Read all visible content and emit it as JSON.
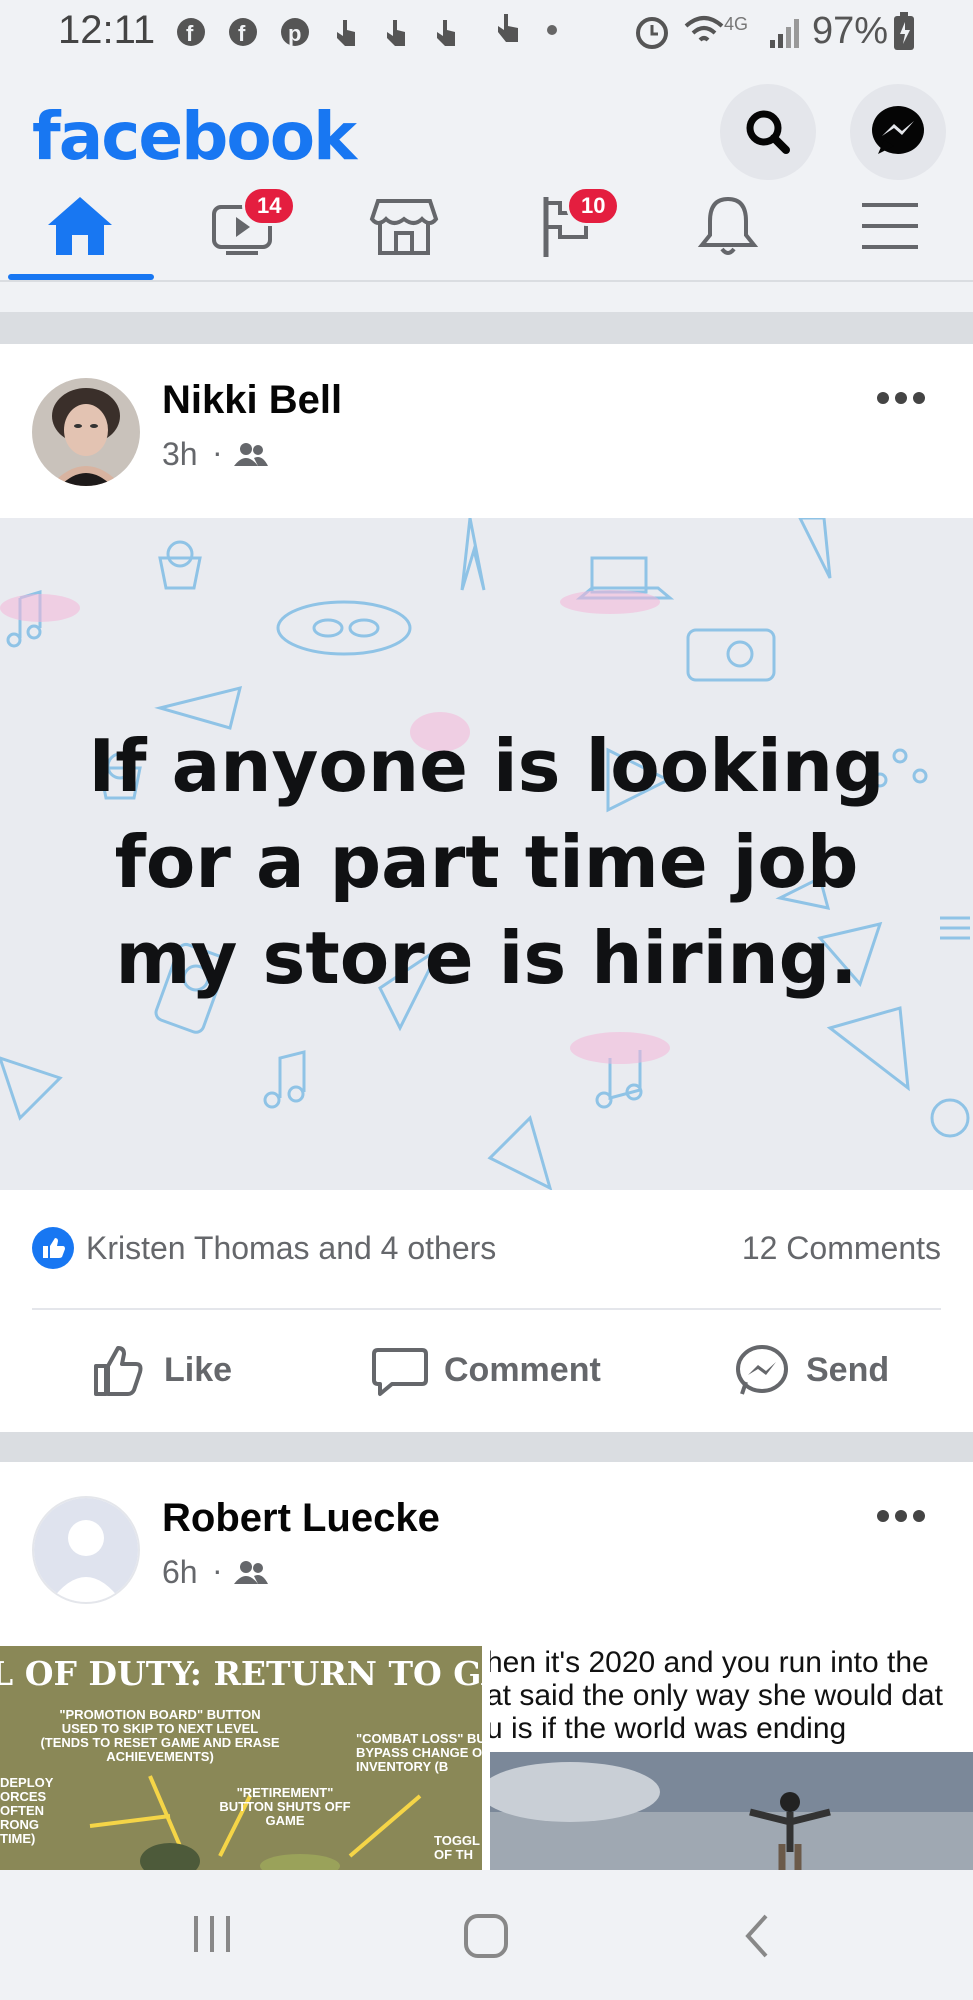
{
  "status_bar": {
    "time": "12:11",
    "left_icons": [
      "facebook-icon",
      "facebook-icon",
      "pinterest-icon",
      "touch-icon",
      "touch-icon",
      "touch-icon",
      "touch-icon"
    ],
    "network": "4G",
    "battery": "97%"
  },
  "header": {
    "logo": "facebook",
    "nav": [
      {
        "name": "home",
        "active": true
      },
      {
        "name": "watch",
        "badge": "14"
      },
      {
        "name": "marketplace"
      },
      {
        "name": "pages",
        "badge": "10"
      },
      {
        "name": "notifications"
      },
      {
        "name": "menu"
      }
    ]
  },
  "posts": [
    {
      "author": "Nikki Bell",
      "time": "3h",
      "audience_icon": "friends-icon",
      "text": "If anyone is looking for a part time job my store is hiring.",
      "reactions": "Kristen Thomas and 4 others",
      "comments": "12 Comments",
      "actions": {
        "like": "Like",
        "comment": "Comment",
        "send": "Send"
      }
    },
    {
      "author": "Robert Luecke",
      "time": "6h",
      "audience_icon": "friends-icon",
      "images": {
        "left": {
          "title": "L OF DUTY: RETURN TO GARR",
          "labels": [
            "\"PROMOTION BOARD\" BUTTON USED TO SKIP TO NEXT LEVEL (TENDS TO RESET GAME AND ERASE ACHIEVEMENTS)",
            "\"COMBAT LOSS\" BU BYPASS CHANGE O INVENTORY (B",
            "\"RETIREMENT\" BUTTON SHUTS OFF GAME",
            "DEPLOY ORCES OFTEN RONG TIME)",
            "TOGGL OF TH"
          ]
        },
        "right": {
          "caption": [
            "hen it's 2020 and you run into the",
            "at said the only way she would dat",
            "u is if the world was ending"
          ]
        }
      }
    }
  ],
  "colors": {
    "brand": "#1877f2",
    "badge": "#e41e3f",
    "background": "#f0f2f5"
  }
}
